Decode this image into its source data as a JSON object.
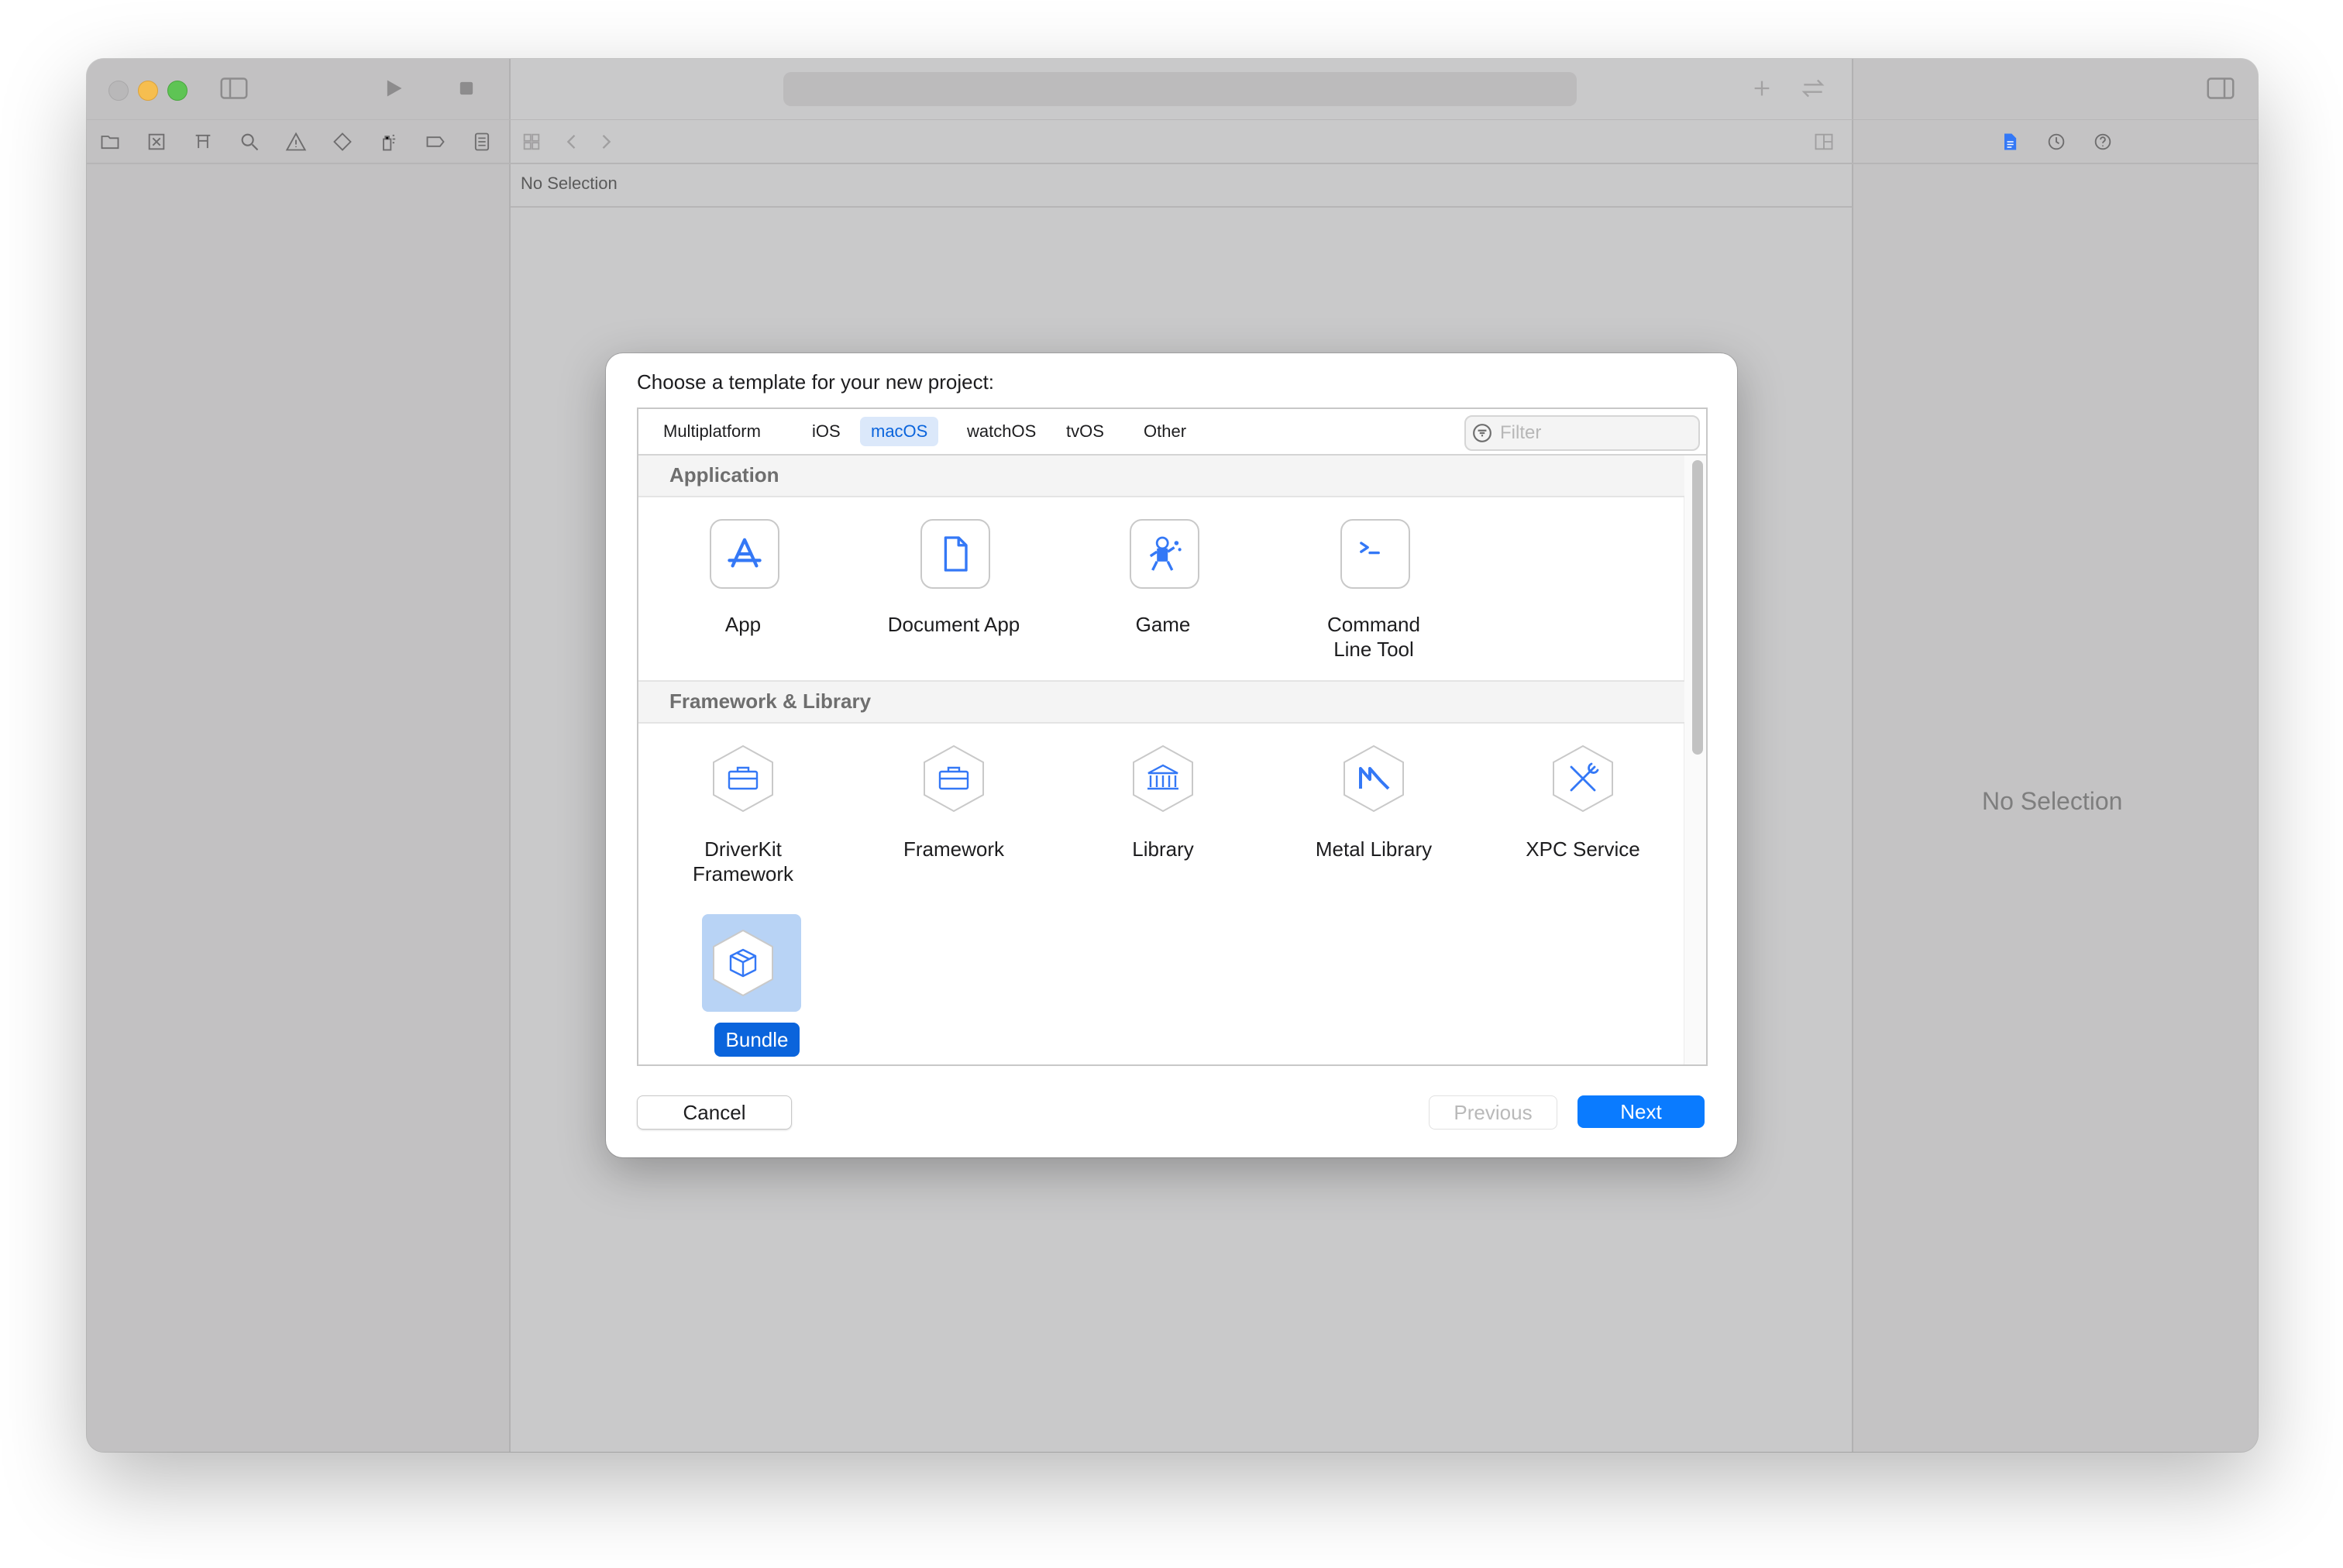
{
  "window": {
    "breadcrumb": "No Selection",
    "inspector_empty": "No Selection"
  },
  "dialog": {
    "title": "Choose a template for your new project:",
    "tabs": [
      "Multiplatform",
      "iOS",
      "macOS",
      "watchOS",
      "tvOS",
      "Other"
    ],
    "selected_tab": "macOS",
    "filter_placeholder": "Filter",
    "sections": [
      {
        "title": "Application",
        "items": [
          {
            "label": "App",
            "icon": "app-store-icon"
          },
          {
            "label": "Document App",
            "icon": "document-icon"
          },
          {
            "label": "Game",
            "icon": "game-icon"
          },
          {
            "label": "Command Line Tool",
            "label_lines": [
              "Command",
              "Line Tool"
            ],
            "icon": "terminal-icon"
          }
        ]
      },
      {
        "title": "Framework & Library",
        "items": [
          {
            "label": "DriverKit Framework",
            "label_lines": [
              "DriverKit",
              "Framework"
            ],
            "icon": "toolbox-icon"
          },
          {
            "label": "Framework",
            "icon": "toolbox-icon"
          },
          {
            "label": "Library",
            "icon": "building-columns-icon"
          },
          {
            "label": "Metal Library",
            "icon": "metal-icon"
          },
          {
            "label": "XPC Service",
            "icon": "tools-icon"
          },
          {
            "label": "Bundle",
            "icon": "package-icon",
            "selected": true
          }
        ]
      }
    ],
    "buttons": {
      "cancel": "Cancel",
      "previous": "Previous",
      "next": "Next"
    },
    "colors": {
      "accent": "#0A64DC",
      "next_button": "#0A7BFF",
      "icon_blue": "#3478F6"
    }
  }
}
